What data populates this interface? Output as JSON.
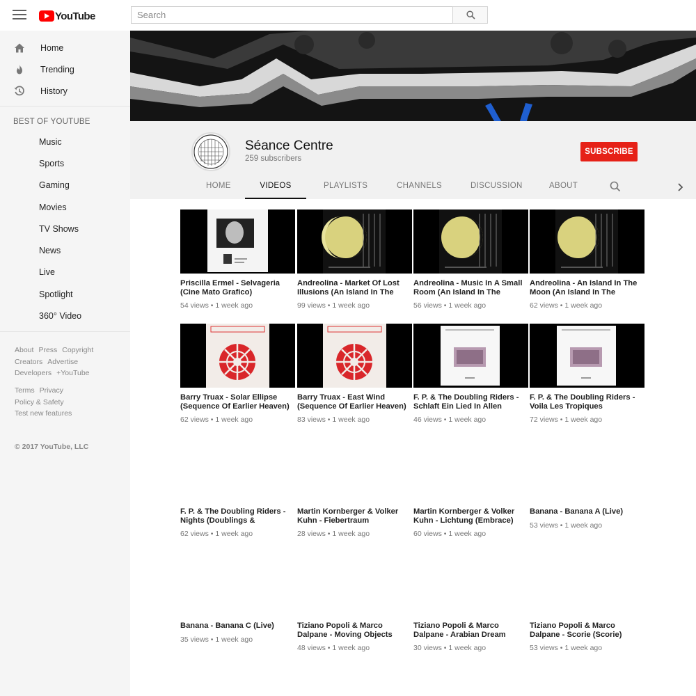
{
  "masthead": {
    "logo_text": "YouTube",
    "search_placeholder": "Search"
  },
  "sidebar": {
    "main": [
      {
        "label": "Home",
        "icon": "home-icon"
      },
      {
        "label": "Trending",
        "icon": "flame-icon"
      },
      {
        "label": "History",
        "icon": "history-icon"
      }
    ],
    "heading": "BEST OF YOUTUBE",
    "best": [
      "Music",
      "Sports",
      "Gaming",
      "Movies",
      "TV Shows",
      "News",
      "Live",
      "Spotlight",
      "360° Video"
    ],
    "footer_1": [
      "About",
      "Press",
      "Copyright",
      "Creators",
      "Advertise",
      "Developers",
      "+YouTube"
    ],
    "footer_2": [
      "Terms",
      "Privacy",
      "Policy & Safety",
      "Test new features"
    ],
    "copyright": "© 2017 YouTube, LLC"
  },
  "channel": {
    "name": "Séance Centre",
    "subscribers": "259 subscribers",
    "subscribe_label": "SUBSCRIBE",
    "tabs": [
      "HOME",
      "VIDEOS",
      "PLAYLISTS",
      "CHANNELS",
      "DISCUSSION",
      "ABOUT"
    ],
    "active_tab": "VIDEOS"
  },
  "videos": [
    {
      "title": "Priscilla Ermel - Selvageria (Cine Mato Grafico)",
      "views": "54 views",
      "age": "1 week ago",
      "thumb": "portrait"
    },
    {
      "title": "Andreolina - Market Of Lost Illusions (An Island In The",
      "views": "99 views",
      "age": "1 week ago",
      "thumb": "moon"
    },
    {
      "title": "Andreolina - Music In A Small Room (An Island In The",
      "views": "56 views",
      "age": "1 week ago",
      "thumb": "moon"
    },
    {
      "title": "Andreolina - An Island In The Moon (An Island In The",
      "views": "62 views",
      "age": "1 week ago",
      "thumb": "moon"
    },
    {
      "title": "Barry Truax - Solar Ellipse (Sequence Of Earlier Heaven)",
      "views": "62 views",
      "age": "1 week ago",
      "thumb": "wheel"
    },
    {
      "title": "Barry Truax - East Wind (Sequence Of Earlier Heaven)",
      "views": "83 views",
      "age": "1 week ago",
      "thumb": "wheel"
    },
    {
      "title": "F. P. & The Doubling Riders - Schlaft Ein Lied In Allen",
      "views": "46 views",
      "age": "1 week ago",
      "thumb": "record"
    },
    {
      "title": "F. P. & The Doubling Riders - Voila Les Tropiques",
      "views": "72 views",
      "age": "1 week ago",
      "thumb": "record"
    },
    {
      "title": "F. P. & The Doubling Riders - Nights (Doublings &",
      "views": "62 views",
      "age": "1 week ago",
      "thumb": "empty"
    },
    {
      "title": "Martin Kornberger & Volker Kuhn - Fiebertraum",
      "views": "28 views",
      "age": "1 week ago",
      "thumb": "empty"
    },
    {
      "title": "Martin Kornberger & Volker Kuhn - Lichtung (Embrace)",
      "views": "60 views",
      "age": "1 week ago",
      "thumb": "empty"
    },
    {
      "title": "Banana - Banana A (Live)",
      "views": "53 views",
      "age": "1 week ago",
      "thumb": "empty"
    },
    {
      "title": "Banana - Banana C (Live)",
      "views": "35 views",
      "age": "1 week ago",
      "thumb": "empty"
    },
    {
      "title": "Tiziano Popoli & Marco Dalpane - Moving Objects",
      "views": "48 views",
      "age": "1 week ago",
      "thumb": "empty"
    },
    {
      "title": "Tiziano Popoli & Marco Dalpane - Arabian Dream",
      "views": "30 views",
      "age": "1 week ago",
      "thumb": "empty"
    },
    {
      "title": "Tiziano Popoli & Marco Dalpane - Scorie (Scorie)",
      "views": "53 views",
      "age": "1 week ago",
      "thumb": "empty"
    }
  ],
  "meta_separator": "•",
  "colors": {
    "brand_red": "#ff0000",
    "subscribe_red": "#e62117"
  }
}
